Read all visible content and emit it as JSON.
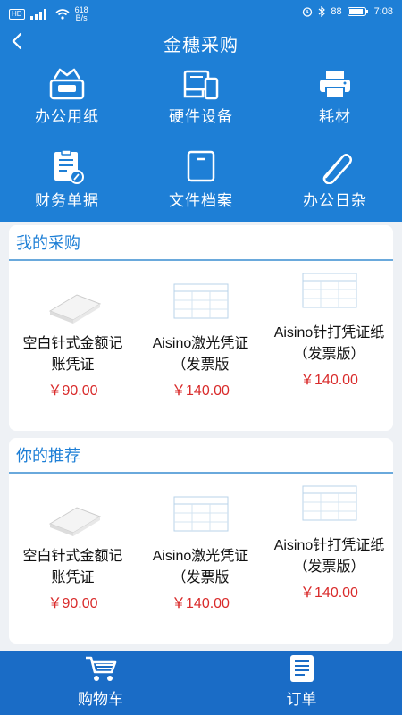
{
  "statusbar": {
    "hd": "HD",
    "net_speed": "618",
    "net_unit": "B/s",
    "battery": "88",
    "time": "7:08"
  },
  "header": {
    "title": "金穗采购"
  },
  "categories": [
    {
      "label": "办公用纸",
      "icon": "tissue-box-icon"
    },
    {
      "label": "硬件设备",
      "icon": "devices-icon"
    },
    {
      "label": "耗材",
      "icon": "printer-icon"
    },
    {
      "label": "财务单据",
      "icon": "document-icon"
    },
    {
      "label": "文件档案",
      "icon": "file-folder-icon"
    },
    {
      "label": "办公日杂",
      "icon": "paperclip-icon"
    }
  ],
  "my_purchases": {
    "title": "我的采购",
    "items": [
      {
        "name": "空白针式金额记账凭证",
        "price": "￥90.00"
      },
      {
        "name": "Aisino激光凭证（发票版",
        "price": "￥140.00"
      },
      {
        "name": "Aisino针打凭证纸（发票版）",
        "price": "￥140.00"
      }
    ]
  },
  "recommended": {
    "title": "你的推荐",
    "items": [
      {
        "name": "空白针式金额记账凭证",
        "price": "￥90.00"
      },
      {
        "name": "Aisino激光凭证（发票版",
        "price": "￥140.00"
      },
      {
        "name": "Aisino针打凭证纸（发票版）",
        "price": "￥140.00"
      }
    ]
  },
  "tabbar": {
    "cart": "购物车",
    "orders": "订单"
  },
  "colors": {
    "primary": "#1e7fd6",
    "tabbar": "#1a6cc6",
    "price": "#d92b2b"
  }
}
